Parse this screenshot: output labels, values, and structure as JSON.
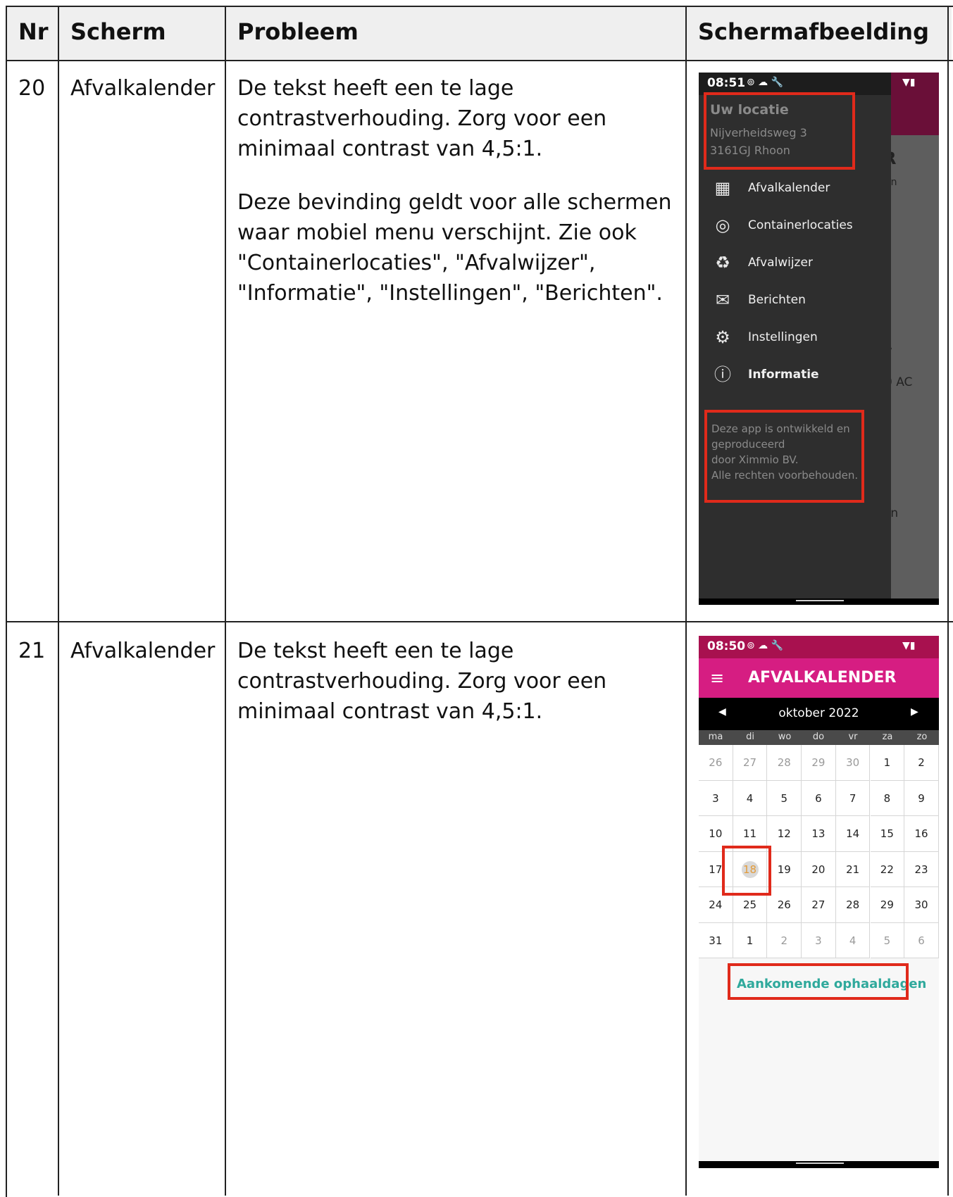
{
  "headers": {
    "nr": "Nr",
    "scherm": "Scherm",
    "probleem": "Probleem",
    "screenshot": "Schermafbeelding"
  },
  "rows": [
    {
      "nr": "20",
      "scherm": "Afvalkalender",
      "probleem": [
        "De tekst heeft een te lage contrastverhouding. Zorg voor een minimaal contrast van 4,5:1.",
        "Deze bevinding geldt voor alle schermen waar mobiel menu verschijnt. Zie ook \"Containerlocaties\", \"Afvalwijzer\", \"Informatie\", \"Instellingen\", \"Berichten\"."
      ]
    },
    {
      "nr": "21",
      "scherm": "Afvalkalender",
      "probleem": [
        "De tekst heeft een te lage contrastverhouding. Zorg voor een minimaal contrast van 4,5:1."
      ]
    }
  ],
  "phone1": {
    "time": "08:51",
    "status_icons": "⊚ ☁ 🔧",
    "status_right": "▼▮",
    "location_title": "Uw locatie",
    "address_line1": "Nijverheidsweg 3",
    "address_line2": "3161GJ Rhoon",
    "menu": [
      {
        "icon": "calendar-icon",
        "glyph": "▦",
        "label": "Afvalkalender"
      },
      {
        "icon": "location-pin-icon",
        "glyph": "◎",
        "label": "Containerlocaties"
      },
      {
        "icon": "recycle-icon",
        "glyph": "♻",
        "label": "Afvalwijzer"
      },
      {
        "icon": "mail-icon",
        "glyph": "✉",
        "label": "Berichten"
      },
      {
        "icon": "gear-icon",
        "glyph": "⚙",
        "label": "Instellingen"
      },
      {
        "icon": "info-icon",
        "glyph": "ⓘ",
        "label": "Informatie"
      }
    ],
    "footer": [
      "Deze app is ontwikkeld en",
      "geproduceerd",
      "door Ximmio BV.",
      "Alle rechten voorbehouden."
    ],
    "behind": {
      "r": "R",
      "en": "en",
      "comma": ",",
      "ac": "0 AC",
      "on": "on"
    }
  },
  "phone2": {
    "time": "08:50",
    "status_icons": "⊚ ☁ 🔧",
    "status_right": "▼▮",
    "menu_glyph": "≡",
    "title": "AFVALKALENDER",
    "month": "oktober 2022",
    "prev": "◀",
    "next": "▶",
    "weekdays": [
      "ma",
      "di",
      "wo",
      "do",
      "vr",
      "za",
      "zo"
    ],
    "days": [
      "26",
      "27",
      "28",
      "29",
      "30",
      "1",
      "2",
      "3",
      "4",
      "5",
      "6",
      "7",
      "8",
      "9",
      "10",
      "11",
      "12",
      "13",
      "14",
      "15",
      "16",
      "17",
      "18",
      "19",
      "20",
      "21",
      "22",
      "23",
      "24",
      "25",
      "26",
      "27",
      "28",
      "29",
      "30",
      "31",
      "1",
      "2",
      "3",
      "4",
      "5",
      "6"
    ],
    "upcoming": "Aankomende ophaaldagen"
  },
  "colors": {
    "highlight": "#e02a1b",
    "brand": "#d61d82",
    "link": "#2fa99c"
  }
}
